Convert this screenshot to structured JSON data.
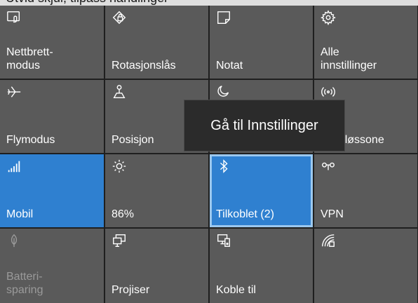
{
  "header": {
    "text": "Utvid skjul, tilpass handlinger"
  },
  "tiles": [
    {
      "label": "Nettbrett-\nmodus",
      "icon": "tablet-mode-icon",
      "state": "off"
    },
    {
      "label": "Rotasjonslås",
      "icon": "rotation-lock-icon",
      "state": "off"
    },
    {
      "label": "Notat",
      "icon": "note-icon",
      "state": "off"
    },
    {
      "label": "Alle\ninnstillinger",
      "icon": "gear-icon",
      "state": "off"
    },
    {
      "label": "Flymodus",
      "icon": "airplane-icon",
      "state": "off"
    },
    {
      "label": "Posisjon",
      "icon": "location-icon",
      "state": "off"
    },
    {
      "label": "",
      "icon": "night-light-icon",
      "state": "off"
    },
    {
      "label": "bil\nsoneløssone",
      "icon": "hotspot-icon",
      "state": "off"
    },
    {
      "label": "Mobil",
      "icon": "cellular-icon",
      "state": "on"
    },
    {
      "label": "86%",
      "icon": "brightness-icon",
      "state": "off"
    },
    {
      "label": "Tilkoblet (2)",
      "icon": "bluetooth-icon",
      "state": "on"
    },
    {
      "label": "VPN",
      "icon": "vpn-icon",
      "state": "off"
    },
    {
      "label": "Batteri-\nsparing",
      "icon": "battery-saver-icon",
      "state": "disabled"
    },
    {
      "label": "Projiser",
      "icon": "project-icon",
      "state": "off"
    },
    {
      "label": "Koble til",
      "icon": "connect-icon",
      "state": "off"
    },
    {
      "label": "",
      "icon": "network-icon",
      "state": "off"
    }
  ],
  "tooltip": {
    "text": "Gå til Innstillinger"
  },
  "colors": {
    "tile": "#5a5a5a",
    "active": "#2f80d0",
    "focus": "#9cc8ee",
    "tooltip_bg": "#2b2b2b"
  }
}
